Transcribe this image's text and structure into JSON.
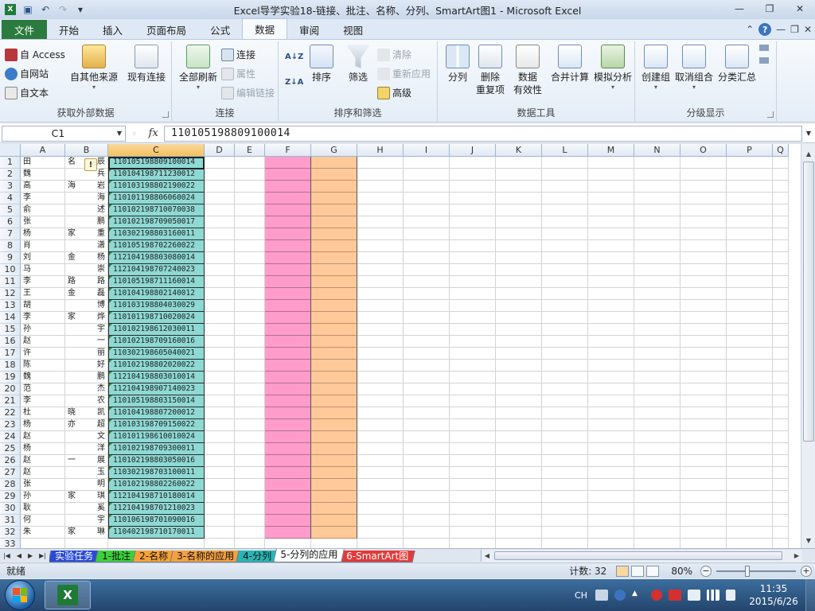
{
  "window": {
    "title": "Excel导学实验18-链接、批注、名称、分列、SmartArt图1 - Microsoft Excel",
    "controls": [
      "—",
      "❐",
      "✕"
    ]
  },
  "qat": {
    "save_icon": "💾",
    "undo": "↶",
    "redo": "↷",
    "customize": "▾"
  },
  "tabs": [
    "文件",
    "开始",
    "插入",
    "页面布局",
    "公式",
    "数据",
    "审阅",
    "视图"
  ],
  "active_tab": "数据",
  "tab_right": {
    "help": "?",
    "min": "—",
    "restore": "❐",
    "close": "✕",
    "collapse": "⌃"
  },
  "ribbon": {
    "get_external": {
      "label": "获取外部数据",
      "access": "自 Access",
      "web": "自网站",
      "text": "自文本",
      "other": "自其他来源",
      "existing": "现有连接"
    },
    "connections": {
      "label": "连接",
      "refresh_all": "全部刷新",
      "connections": "连接",
      "properties": "属性",
      "edit_links": "编辑链接"
    },
    "sort_filter": {
      "label": "排序和筛选",
      "sort": "排序",
      "filter": "筛选",
      "clear": "清除",
      "reapply": "重新应用",
      "advanced": "高级",
      "az": "A↓Z",
      "za": "Z↓A"
    },
    "data_tools": {
      "label": "数据工具",
      "text_to_columns": "分列",
      "remove_duplicates_1": "删除",
      "remove_duplicates_2": "重复项",
      "validation_1": "数据",
      "validation_2": "有效性",
      "consolidate": "合并计算",
      "what_if": "模拟分析"
    },
    "outline": {
      "label": "分级显示",
      "group": "创建组",
      "ungroup": "取消组合",
      "subtotal": "分类汇总"
    }
  },
  "formula_bar": {
    "name_box": "C1",
    "fx": "fx",
    "formula": "110105198809100014"
  },
  "columns": [
    "A",
    "B",
    "C",
    "D",
    "E",
    "F",
    "G",
    "H",
    "I",
    "J",
    "K",
    "L",
    "M",
    "N",
    "O",
    "P",
    "Q"
  ],
  "selected_column": "C",
  "rows": [
    {
      "n": "1",
      "a": "田",
      "b1": "名",
      "b2": "辰",
      "c": "110105198809100014"
    },
    {
      "n": "2",
      "a": "魏",
      "b1": "",
      "b2": "兵",
      "c": "110104198711230012"
    },
    {
      "n": "3",
      "a": "高",
      "b1": "海",
      "b2": "岩",
      "c": "110103198802190022"
    },
    {
      "n": "4",
      "a": "李",
      "b1": "",
      "b2": "海",
      "c": "110101198806060024"
    },
    {
      "n": "5",
      "a": "俞",
      "b1": "",
      "b2": "述",
      "c": "110102198710070038"
    },
    {
      "n": "6",
      "a": "张",
      "b1": "",
      "b2": "鹏",
      "c": "110102198709050017"
    },
    {
      "n": "7",
      "a": "杨",
      "b1": "家",
      "b2": "重",
      "c": "110302198803160011"
    },
    {
      "n": "8",
      "a": "肖",
      "b1": "",
      "b2": "潇",
      "c": "110105198702260022"
    },
    {
      "n": "9",
      "a": "刘",
      "b1": "金",
      "b2": "杨",
      "c": "112104198803080014"
    },
    {
      "n": "10",
      "a": "马",
      "b1": "",
      "b2": "崇",
      "c": "112104198707240023"
    },
    {
      "n": "11",
      "a": "李",
      "b1": "路",
      "b2": "路",
      "c": "110105198711160014"
    },
    {
      "n": "12",
      "a": "王",
      "b1": "金",
      "b2": "磊",
      "c": "110104198802140012"
    },
    {
      "n": "13",
      "a": "胡",
      "b1": "",
      "b2": "博",
      "c": "110103198804030029"
    },
    {
      "n": "14",
      "a": "李",
      "b1": "家",
      "b2": "烨",
      "c": "110101198710020024"
    },
    {
      "n": "15",
      "a": "孙",
      "b1": "",
      "b2": "宇",
      "c": "110102198612030011"
    },
    {
      "n": "16",
      "a": "赵",
      "b1": "",
      "b2": "一",
      "c": "110102198709160016"
    },
    {
      "n": "17",
      "a": "许",
      "b1": "",
      "b2": "丽",
      "c": "110302198605040021"
    },
    {
      "n": "18",
      "a": "陈",
      "b1": "",
      "b2": "好",
      "c": "110102198802020022"
    },
    {
      "n": "19",
      "a": "魏",
      "b1": "",
      "b2": "鹏",
      "c": "112104198803010014"
    },
    {
      "n": "20",
      "a": "范",
      "b1": "",
      "b2": "杰",
      "c": "112104198907140023"
    },
    {
      "n": "21",
      "a": "李",
      "b1": "",
      "b2": "农",
      "c": "110105198803150014"
    },
    {
      "n": "22",
      "a": "杜",
      "b1": "晓",
      "b2": "凯",
      "c": "110104198807200012"
    },
    {
      "n": "23",
      "a": "杨",
      "b1": "亦",
      "b2": "超",
      "c": "110103198709150022"
    },
    {
      "n": "24",
      "a": "赵",
      "b1": "",
      "b2": "文",
      "c": "110101198610010024"
    },
    {
      "n": "25",
      "a": "杨",
      "b1": "",
      "b2": "洋",
      "c": "110102198709300011"
    },
    {
      "n": "26",
      "a": "赵",
      "b1": "一",
      "b2": "展",
      "c": "110102198803050016"
    },
    {
      "n": "27",
      "a": "赵",
      "b1": "",
      "b2": "玉",
      "c": "110302198703100011"
    },
    {
      "n": "28",
      "a": "张",
      "b1": "",
      "b2": "明",
      "c": "110102198802260022"
    },
    {
      "n": "29",
      "a": "孙",
      "b1": "家",
      "b2": "琪",
      "c": "112104198710180014"
    },
    {
      "n": "30",
      "a": "耿",
      "b1": "",
      "b2": "奚",
      "c": "112104198701210023"
    },
    {
      "n": "31",
      "a": "何",
      "b1": "",
      "b2": "宇",
      "c": "110106198701090016"
    },
    {
      "n": "32",
      "a": "朱",
      "b1": "家",
      "b2": "琳",
      "c": "110402198710170011"
    },
    {
      "n": "33",
      "a": "",
      "b1": "",
      "b2": "",
      "c": ""
    }
  ],
  "sheet_tabs": [
    {
      "label": "实验任务",
      "color": "#2a4ad6"
    },
    {
      "label": "1-批注",
      "color": "#3bd13b"
    },
    {
      "label": "2-名称",
      "color": "#f7a237"
    },
    {
      "label": "3-名称的应用",
      "color": "#f3a040"
    },
    {
      "label": "4-分列",
      "color": "#2ab5b5"
    },
    {
      "label": "5-分列的应用",
      "color": "#ffffff"
    },
    {
      "label": "6-SmartArt图",
      "color": "#e33a3a"
    }
  ],
  "active_sheet": "5-分列的应用",
  "status": {
    "ready": "就绪",
    "count": "计数: 32",
    "zoom": "80%",
    "zoom_value": 0.8
  },
  "taskbar": {
    "lang": "CH",
    "time": "11:35",
    "date": "2015/6/26"
  },
  "colors": {
    "col_c_fill": "#8ed9d4",
    "col_f_fill": "#ff9ccb",
    "col_g_fill": "#ffc99a",
    "file_tab": "#2a7b3d"
  }
}
